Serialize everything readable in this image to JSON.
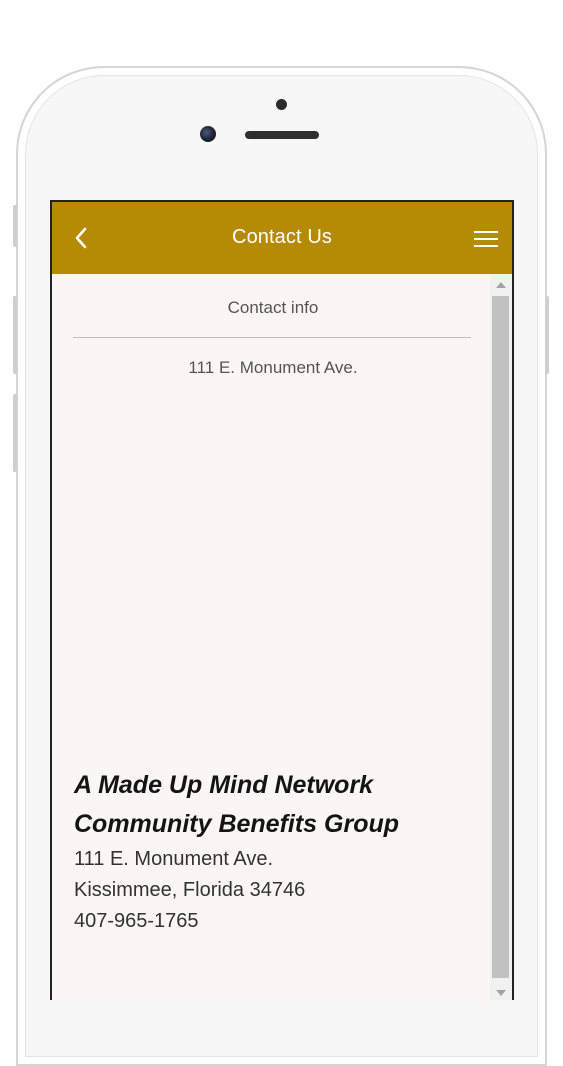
{
  "appbar": {
    "title": "Contact Us",
    "back_icon": "chevron-left-icon",
    "menu_icon": "hamburger-menu-icon",
    "background_color": "#b58a05"
  },
  "contact": {
    "section_title": "Contact info",
    "address_summary": "111 E. Monument Ave.",
    "org_name_line1": "A Made Up Mind Network",
    "org_name_line2": "Community Benefits Group",
    "street": "111 E. Monument Ave.",
    "city_state_zip": "Kissimmee, Florida 34746",
    "phone": "407-965-1765"
  },
  "colors": {
    "screen_background": "#fbf5f3",
    "text_gray": "#555555"
  }
}
